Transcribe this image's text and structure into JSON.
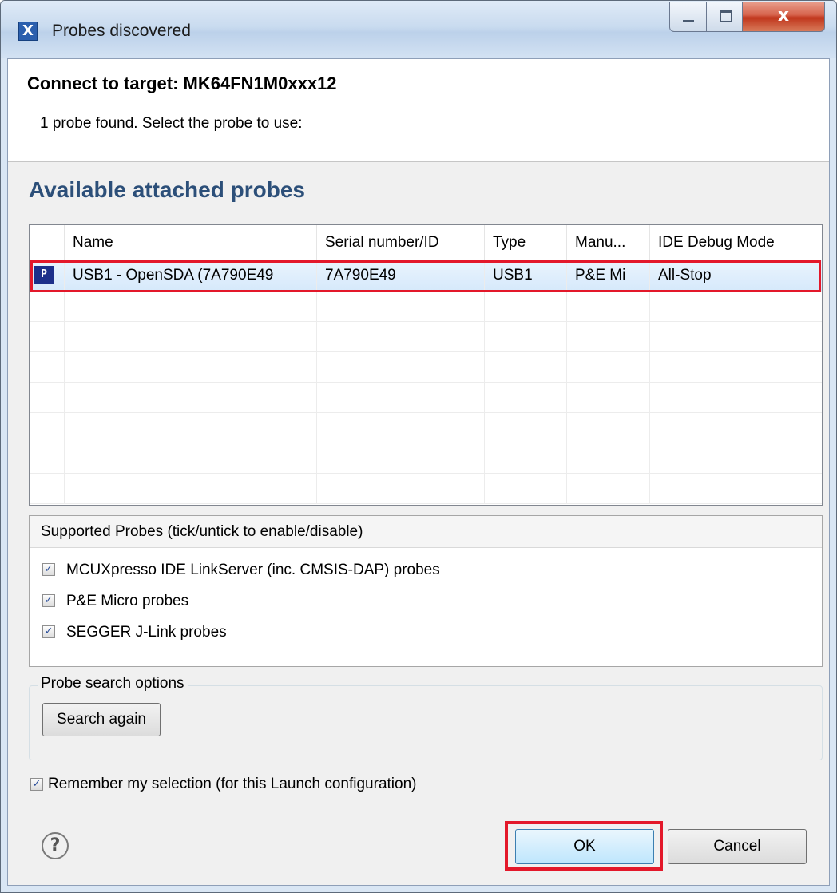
{
  "window": {
    "title": "Probes discovered"
  },
  "header": {
    "title": "Connect to target: MK64FN1M0xxx12",
    "description": "1 probe found. Select the probe to use:"
  },
  "section": {
    "title": "Available attached probes"
  },
  "table": {
    "columns": [
      "Name",
      "Serial number/ID",
      "Type",
      "Manu...",
      "IDE Debug Mode"
    ],
    "rows": [
      {
        "name": "USB1 - OpenSDA (7A790E49",
        "serial": "7A790E49",
        "type": "USB1",
        "manufacturer": "P&E Mi",
        "mode": "All-Stop",
        "icon": "probe-icon",
        "selected": true
      }
    ]
  },
  "supported": {
    "header": "Supported Probes (tick/untick to enable/disable)",
    "items": [
      {
        "label": "MCUXpresso IDE LinkServer (inc. CMSIS-DAP) probes",
        "checked": true
      },
      {
        "label": "P&E Micro probes",
        "checked": true
      },
      {
        "label": "SEGGER J-Link probes",
        "checked": true
      }
    ]
  },
  "search": {
    "legend": "Probe search options",
    "button": "Search again"
  },
  "remember": {
    "label": "Remember my selection (for this Launch configuration)",
    "checked": true
  },
  "footer": {
    "ok": "OK",
    "cancel": "Cancel",
    "help_icon": "help-icon"
  },
  "colors": {
    "highlight": "#e3182a",
    "section_title": "#2c4f79"
  }
}
